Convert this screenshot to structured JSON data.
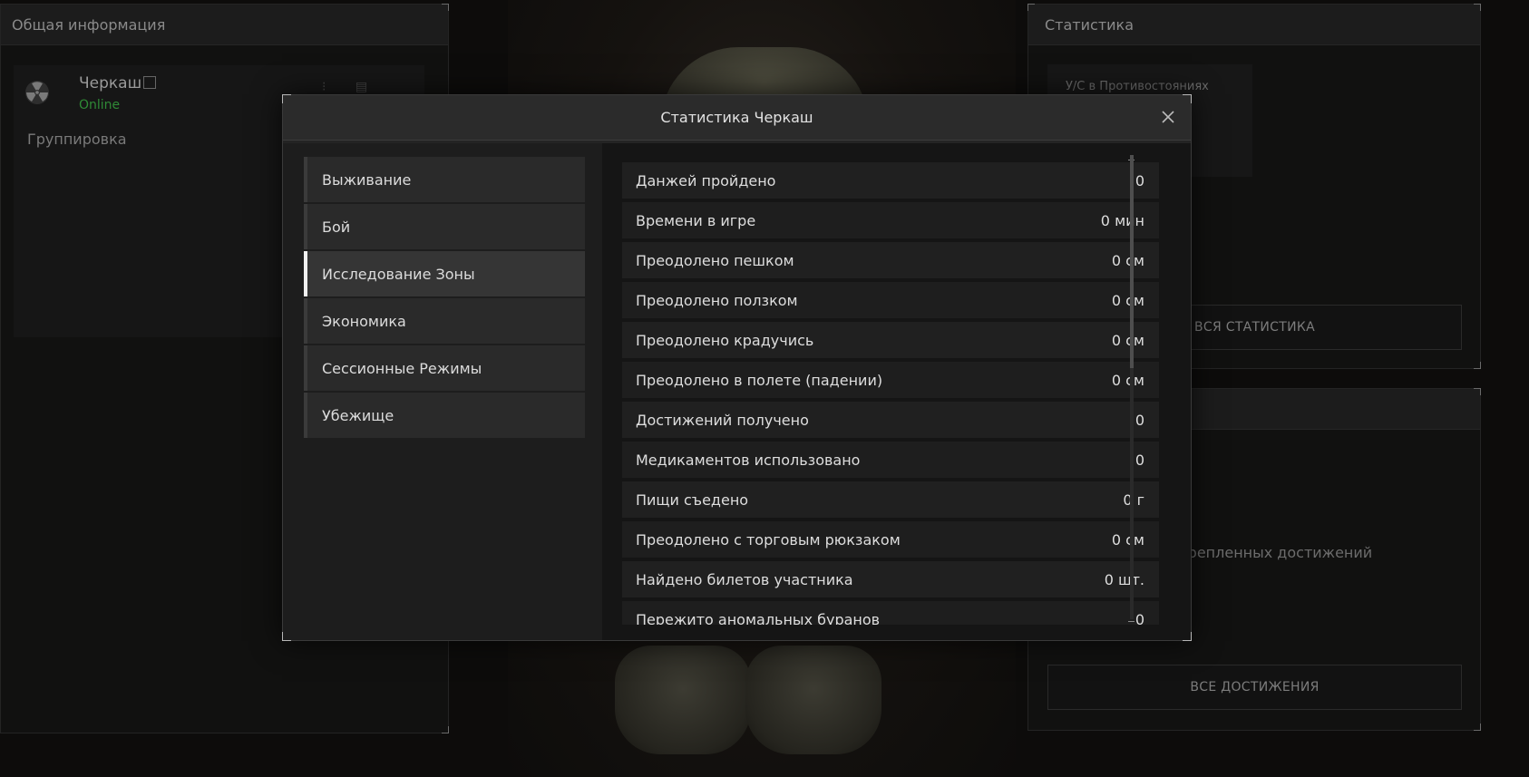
{
  "background": {
    "left_panel": {
      "title": "Общая информация",
      "player_name": "Черкаш",
      "status": "Online",
      "group_label": "Группировка"
    },
    "right_panel": {
      "title": "Статистика",
      "stat_label": "У/С в Противостояниях",
      "all_stats_button": "ВСЯ СТАТИСТИКА",
      "pinned_text": "крепленных достижений",
      "all_achievements_button": "ВСЕ ДОСТИЖЕНИЯ"
    }
  },
  "modal": {
    "title": "Статистика Черкаш",
    "nav": [
      {
        "label": "Выживание",
        "active": false
      },
      {
        "label": "Бой",
        "active": false
      },
      {
        "label": "Исследование Зоны",
        "active": true
      },
      {
        "label": "Экономика",
        "active": false
      },
      {
        "label": "Сессионные Режимы",
        "active": false
      },
      {
        "label": "Убежище",
        "active": false
      }
    ],
    "stats": [
      {
        "label": "Данжей пройдено",
        "value": "0"
      },
      {
        "label": "Времени в игре",
        "value": "0 мин"
      },
      {
        "label": "Преодолено пешком",
        "value": "0 см"
      },
      {
        "label": "Преодолено ползком",
        "value": "0 см"
      },
      {
        "label": "Преодолено крадучись",
        "value": "0 см"
      },
      {
        "label": "Преодолено в полете (падении)",
        "value": "0 см"
      },
      {
        "label": "Достижений получено",
        "value": "0"
      },
      {
        "label": "Медикаментов использовано",
        "value": "0"
      },
      {
        "label": "Пищи съедено",
        "value": "0 г"
      },
      {
        "label": "Преодолено с торговым рюкзаком",
        "value": "0 см"
      },
      {
        "label": "Найдено билетов участника",
        "value": "0 шт."
      },
      {
        "label": "Пережито аномальных буранов",
        "value": "0"
      }
    ]
  },
  "icons": {
    "close": "close-icon",
    "radiation": "radiation-icon",
    "copy": "copy-icon"
  },
  "colors": {
    "accent_online": "#2f8a36",
    "active_nav_marker": "#f0f0f0"
  }
}
